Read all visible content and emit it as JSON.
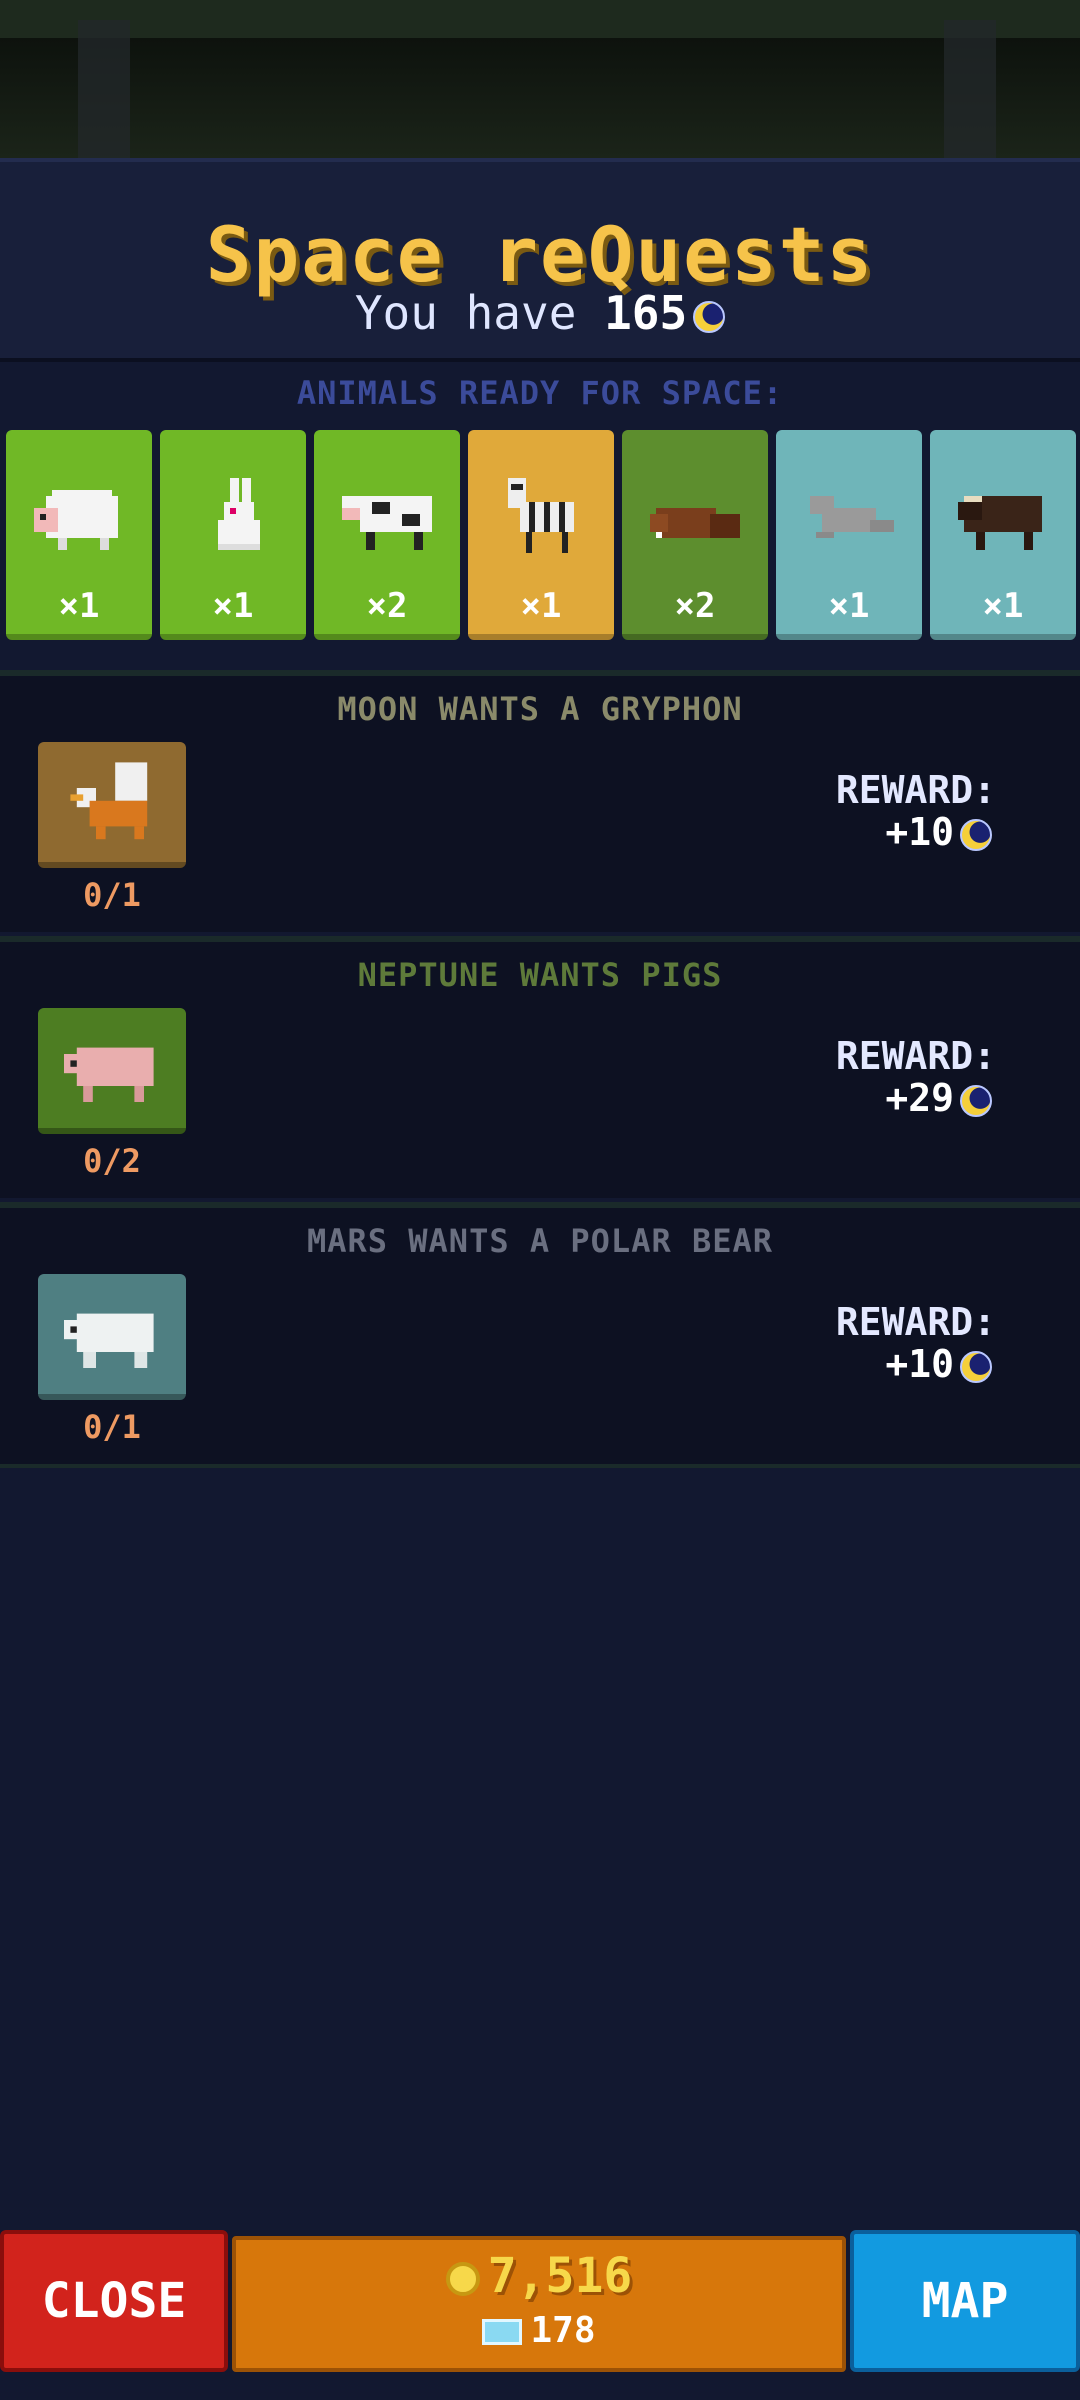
{
  "header": {
    "title": "Space reQuests",
    "balance_prefix": "You have ",
    "balance_value": "165"
  },
  "ready": {
    "label": "ANIMALS READY FOR SPACE:",
    "animals": [
      {
        "name": "sheep",
        "count": "×1",
        "bg": "#70b826"
      },
      {
        "name": "rabbit",
        "count": "×1",
        "bg": "#70b826"
      },
      {
        "name": "cow",
        "count": "×2",
        "bg": "#70b826"
      },
      {
        "name": "zebra",
        "count": "×1",
        "bg": "#e0a93a"
      },
      {
        "name": "beaver",
        "count": "×2",
        "bg": "#5d8e2e"
      },
      {
        "name": "seal",
        "count": "×1",
        "bg": "#6fb5b9"
      },
      {
        "name": "musk-ox",
        "count": "×1",
        "bg": "#6fb5b9"
      }
    ]
  },
  "quests": [
    {
      "title": "MOON WANTS A GRYPHON",
      "animal": "gryphon",
      "progress": "0/1",
      "reward_label": "REWARD:",
      "reward_value": "+10",
      "title_color": "#8a8a6a",
      "tile_color": "#8f6a30"
    },
    {
      "title": "NEPTUNE WANTS PIGS",
      "animal": "pig",
      "progress": "0/2",
      "reward_label": "REWARD:",
      "reward_value": "+29",
      "title_color": "#5e7a3a",
      "tile_color": "#4d7d22"
    },
    {
      "title": "MARS WANTS A POLAR BEAR",
      "animal": "polar-bear",
      "progress": "0/1",
      "reward_label": "REWARD:",
      "reward_value": "+10",
      "title_color": "#6a6f80",
      "tile_color": "#4f7f82"
    }
  ],
  "bottom": {
    "close_label": "CLOSE",
    "coins": "7,516",
    "gems": "178",
    "map_label": "MAP"
  }
}
